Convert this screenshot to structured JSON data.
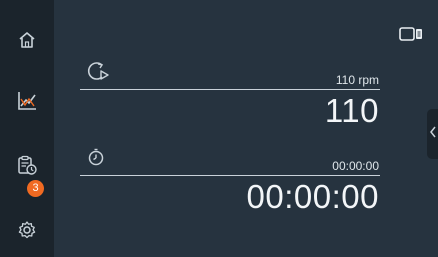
{
  "nav": {
    "items": [
      {
        "name": "home",
        "icon": "home-icon"
      },
      {
        "name": "graph",
        "icon": "chart-icon"
      },
      {
        "name": "tasks",
        "icon": "clipboard-clock-icon",
        "badge": "3"
      },
      {
        "name": "settings",
        "icon": "gear-icon"
      }
    ]
  },
  "speed": {
    "icon": "rotation-speed-icon",
    "setpoint_label": "110 rpm",
    "actual_value": "110"
  },
  "timer": {
    "icon": "timer-icon",
    "setpoint_label": "00:00:00",
    "actual_value": "00:00:00"
  },
  "colors": {
    "background": "#26333f",
    "sidebar": "#1b242c",
    "badge": "#f06a22",
    "text": "#e9eef2"
  }
}
